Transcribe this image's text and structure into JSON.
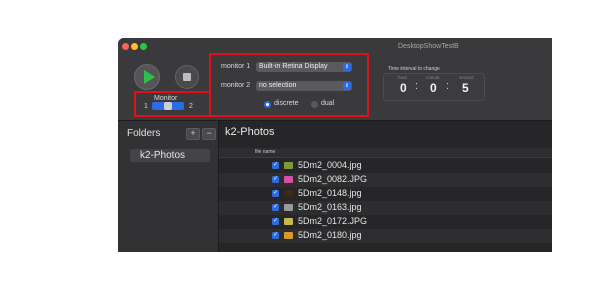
{
  "window": {
    "title": "DesktopShowTestB",
    "traffic_lights": [
      "close",
      "minimize",
      "zoom"
    ]
  },
  "controls": {
    "play_icon": "play-icon",
    "stop_icon": "stop-icon",
    "monitor_label": "Monitor",
    "monitor_min": "1",
    "monitor_max": "2",
    "monitor_value": 1
  },
  "monitors": {
    "monitor1_label": "monitor 1",
    "monitor1_value": "Built-in Retina Display",
    "monitor2_label": "monitor 2",
    "monitor2_value": "no selection",
    "mode_discrete": "discrete",
    "mode_dual": "dual",
    "selected_mode": "discrete"
  },
  "time": {
    "title": "Time interval to change",
    "hour_label": "hour",
    "minute_label": "minute",
    "second_label": "second",
    "hour": "0",
    "minute": "0",
    "second": "5",
    "separator": ":"
  },
  "sidebar": {
    "title": "Folders",
    "add_label": "+",
    "remove_label": "−",
    "items": [
      {
        "label": "k2-Photos"
      }
    ]
  },
  "main": {
    "title": "k2-Photos",
    "column_header": "file name",
    "files": [
      {
        "name": "5Dm2_0004.jpg",
        "checked": true,
        "thumb_color": "#7a9b3a"
      },
      {
        "name": "5Dm2_0082.JPG",
        "checked": true,
        "thumb_color": "#d94fa8"
      },
      {
        "name": "5Dm2_0148.jpg",
        "checked": true,
        "thumb_color": "#3b2a1a"
      },
      {
        "name": "5Dm2_0163.jpg",
        "checked": true,
        "thumb_color": "#9a9a9a"
      },
      {
        "name": "5Dm2_0172.JPG",
        "checked": true,
        "thumb_color": "#c9b84a"
      },
      {
        "name": "5Dm2_0180.jpg",
        "checked": true,
        "thumb_color": "#d49a2a"
      }
    ]
  },
  "colors": {
    "accent": "#2a6be6",
    "annotation_red": "#e0101d",
    "play_green": "#2ec14a"
  }
}
